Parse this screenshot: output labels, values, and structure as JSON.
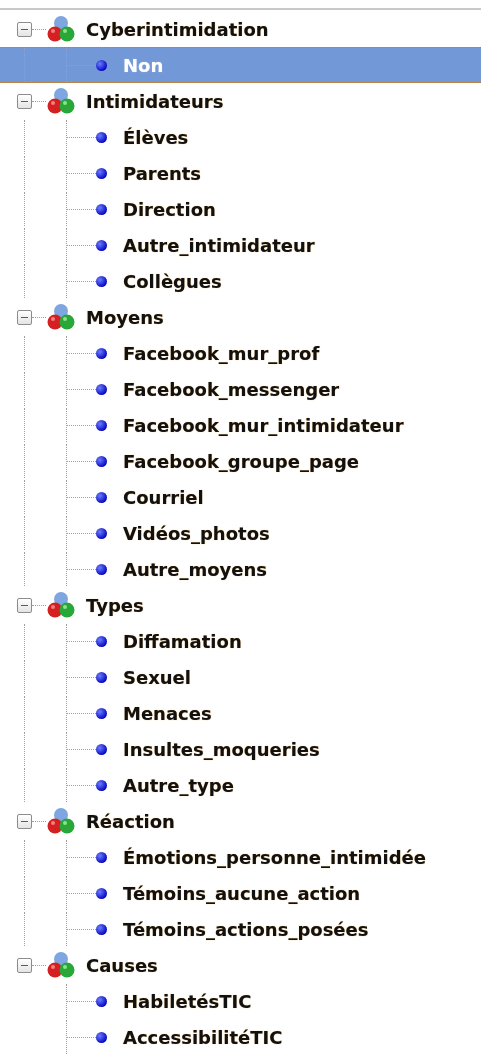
{
  "tree": [
    {
      "label": "Cyberintimidation",
      "expanded": true,
      "selected": false,
      "children": [
        {
          "label": "Non",
          "selected": true
        }
      ]
    },
    {
      "label": "Intimidateurs",
      "expanded": true,
      "selected": false,
      "children": [
        {
          "label": "Élèves",
          "selected": false
        },
        {
          "label": "Parents",
          "selected": false
        },
        {
          "label": "Direction",
          "selected": false
        },
        {
          "label": "Autre_intimidateur",
          "selected": false
        },
        {
          "label": "Collègues",
          "selected": false
        }
      ]
    },
    {
      "label": "Moyens",
      "expanded": true,
      "selected": false,
      "children": [
        {
          "label": "Facebook_mur_prof",
          "selected": false
        },
        {
          "label": "Facebook_messenger",
          "selected": false
        },
        {
          "label": "Facebook_mur_intimidateur",
          "selected": false
        },
        {
          "label": "Facebook_groupe_page",
          "selected": false
        },
        {
          "label": "Courriel",
          "selected": false
        },
        {
          "label": "Vidéos_photos",
          "selected": false
        },
        {
          "label": "Autre_moyens",
          "selected": false
        }
      ]
    },
    {
      "label": "Types",
      "expanded": true,
      "selected": false,
      "children": [
        {
          "label": "Diffamation",
          "selected": false
        },
        {
          "label": "Sexuel",
          "selected": false
        },
        {
          "label": "Menaces",
          "selected": false
        },
        {
          "label": "Insultes_moqueries",
          "selected": false
        },
        {
          "label": "Autre_type",
          "selected": false
        }
      ]
    },
    {
      "label": "Réaction",
      "expanded": true,
      "selected": false,
      "children": [
        {
          "label": "Émotions_personne_intimidée",
          "selected": false
        },
        {
          "label": "Témoins_aucune_action",
          "selected": false
        },
        {
          "label": "Témoins_actions_posées",
          "selected": false
        }
      ]
    },
    {
      "label": "Causes",
      "expanded": true,
      "selected": false,
      "children": [
        {
          "label": "HabiletésTIC",
          "selected": false
        },
        {
          "label": "AccessibilitéTIC",
          "selected": false
        }
      ]
    }
  ]
}
